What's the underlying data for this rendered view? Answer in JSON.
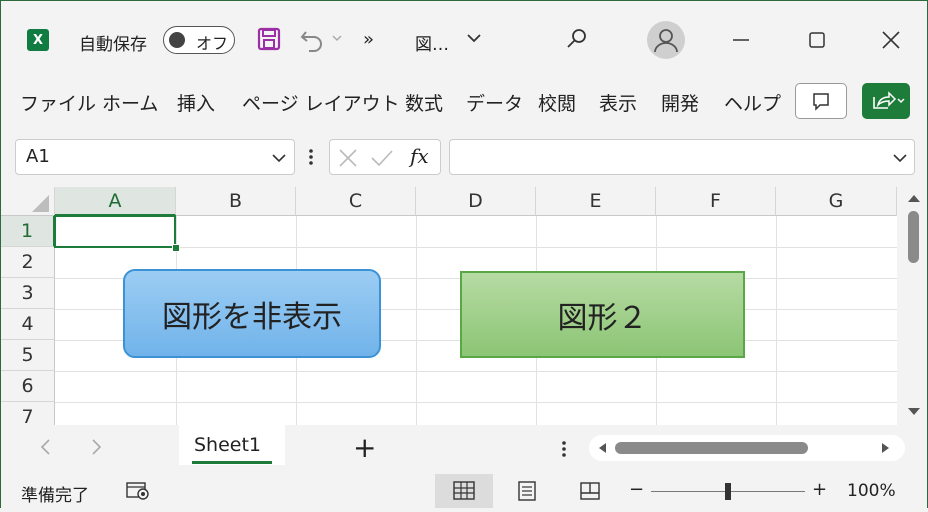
{
  "titlebar": {
    "app_icon": "X",
    "autosave_label": "自動保存",
    "autosave_state": "オフ",
    "more_symbol": "»",
    "doc_title": "図…"
  },
  "menu": {
    "items": [
      "ファイル",
      "ホーム",
      "挿入",
      "ページ レイアウト",
      "数式",
      "データ",
      "校閲",
      "表示",
      "開発",
      "ヘルプ"
    ]
  },
  "formula_bar": {
    "name_box": "A1",
    "fx_label": "fx",
    "formula_value": ""
  },
  "grid": {
    "columns": [
      "A",
      "B",
      "C",
      "D",
      "E",
      "F",
      "G"
    ],
    "rows": [
      "1",
      "2",
      "3",
      "4",
      "5",
      "6",
      "7"
    ],
    "selected_cell": "A1"
  },
  "shapes": {
    "shape1_text": "図形を非表示",
    "shape2_text": "図形２"
  },
  "sheets": {
    "active_tab": "Sheet1",
    "add_symbol": "+"
  },
  "status": {
    "ready_text": "準備完了",
    "zoom_minus": "−",
    "zoom_plus": "+",
    "zoom_level": "100%",
    "zoom_fraction": 0.5
  },
  "colors": {
    "accent": "#1e7c3a",
    "shape1_fill": "#85c0ef",
    "shape2_fill": "#a3d08f"
  }
}
